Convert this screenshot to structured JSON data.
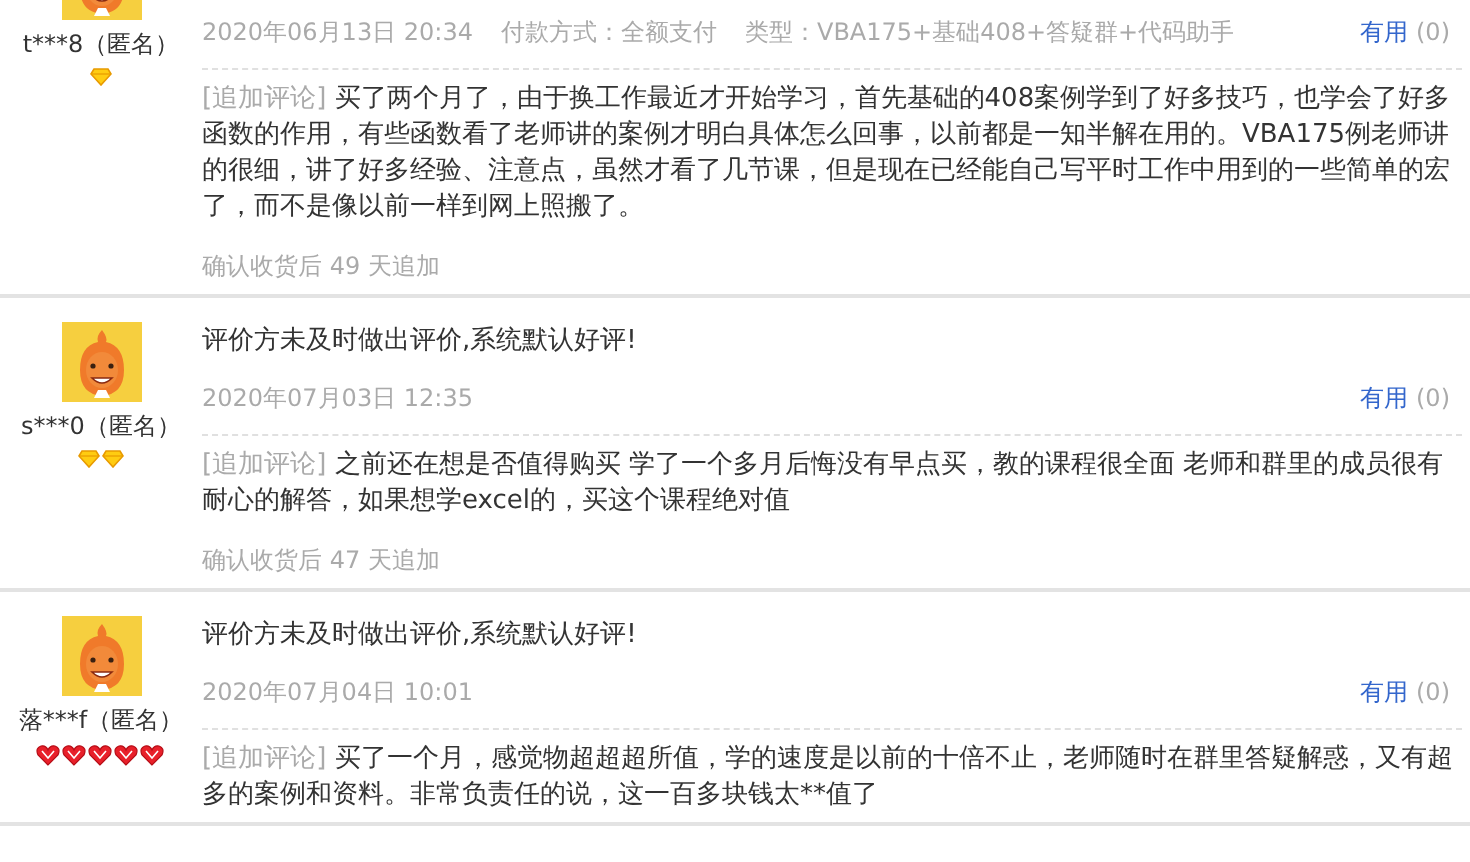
{
  "reviews": [
    {
      "user": "t***8（匿名）",
      "rank_icons": [
        {
          "kind": "diamond"
        }
      ],
      "date": "2020年06月13日 20:34",
      "payment": "付款方式：全额支付",
      "type": "类型：VBA175+基础408+答疑群+代码助手",
      "useful": "有用",
      "useful_count": "(0)",
      "append_tag": "[追加评论]",
      "append_text": "买了两个月了，由于换工作最近才开始学习，首先基础的408案例学到了好多技巧，也学会了好多函数的作用，有些函数看了老师讲的案例才明白具体怎么回事，以前都是一知半解在用的。VBA175例老师讲的很细，讲了好多经验、注意点，虽然才看了几节课，但是现在已经能自己写平时工作中用到的一些简单的宏了，而不是像以前一样到网上照搬了。",
      "footer": "确认收货后 49 天追加"
    },
    {
      "user": "s***0（匿名）",
      "rank_icons": [
        {
          "kind": "diamond"
        },
        {
          "kind": "diamond"
        }
      ],
      "comment": "评价方未及时做出评价,系统默认好评!",
      "date": "2020年07月03日 12:35",
      "useful": "有用",
      "useful_count": "(0)",
      "append_tag": "[追加评论]",
      "append_text": "之前还在想是否值得购买 学了一个多月后悔没有早点买，教的课程很全面 老师和群里的成员很有耐心的解答，如果想学excel的，买这个课程绝对值",
      "footer": "确认收货后 47 天追加"
    },
    {
      "user": "落***f（匿名）",
      "rank_icons": [
        {
          "kind": "heart"
        },
        {
          "kind": "heart"
        },
        {
          "kind": "heart"
        },
        {
          "kind": "heart"
        },
        {
          "kind": "heart"
        }
      ],
      "comment": "评价方未及时做出评价,系统默认好评!",
      "date": "2020年07月04日 10:01",
      "useful": "有用",
      "useful_count": "(0)",
      "append_tag": "[追加评论]",
      "append_text": "买了一个月，感觉物超超超所值，学的速度是以前的十倍不止，老师随时在群里答疑解惑，又有超多的案例和资料。非常负责任的说，这一百多块钱太**值了"
    }
  ]
}
